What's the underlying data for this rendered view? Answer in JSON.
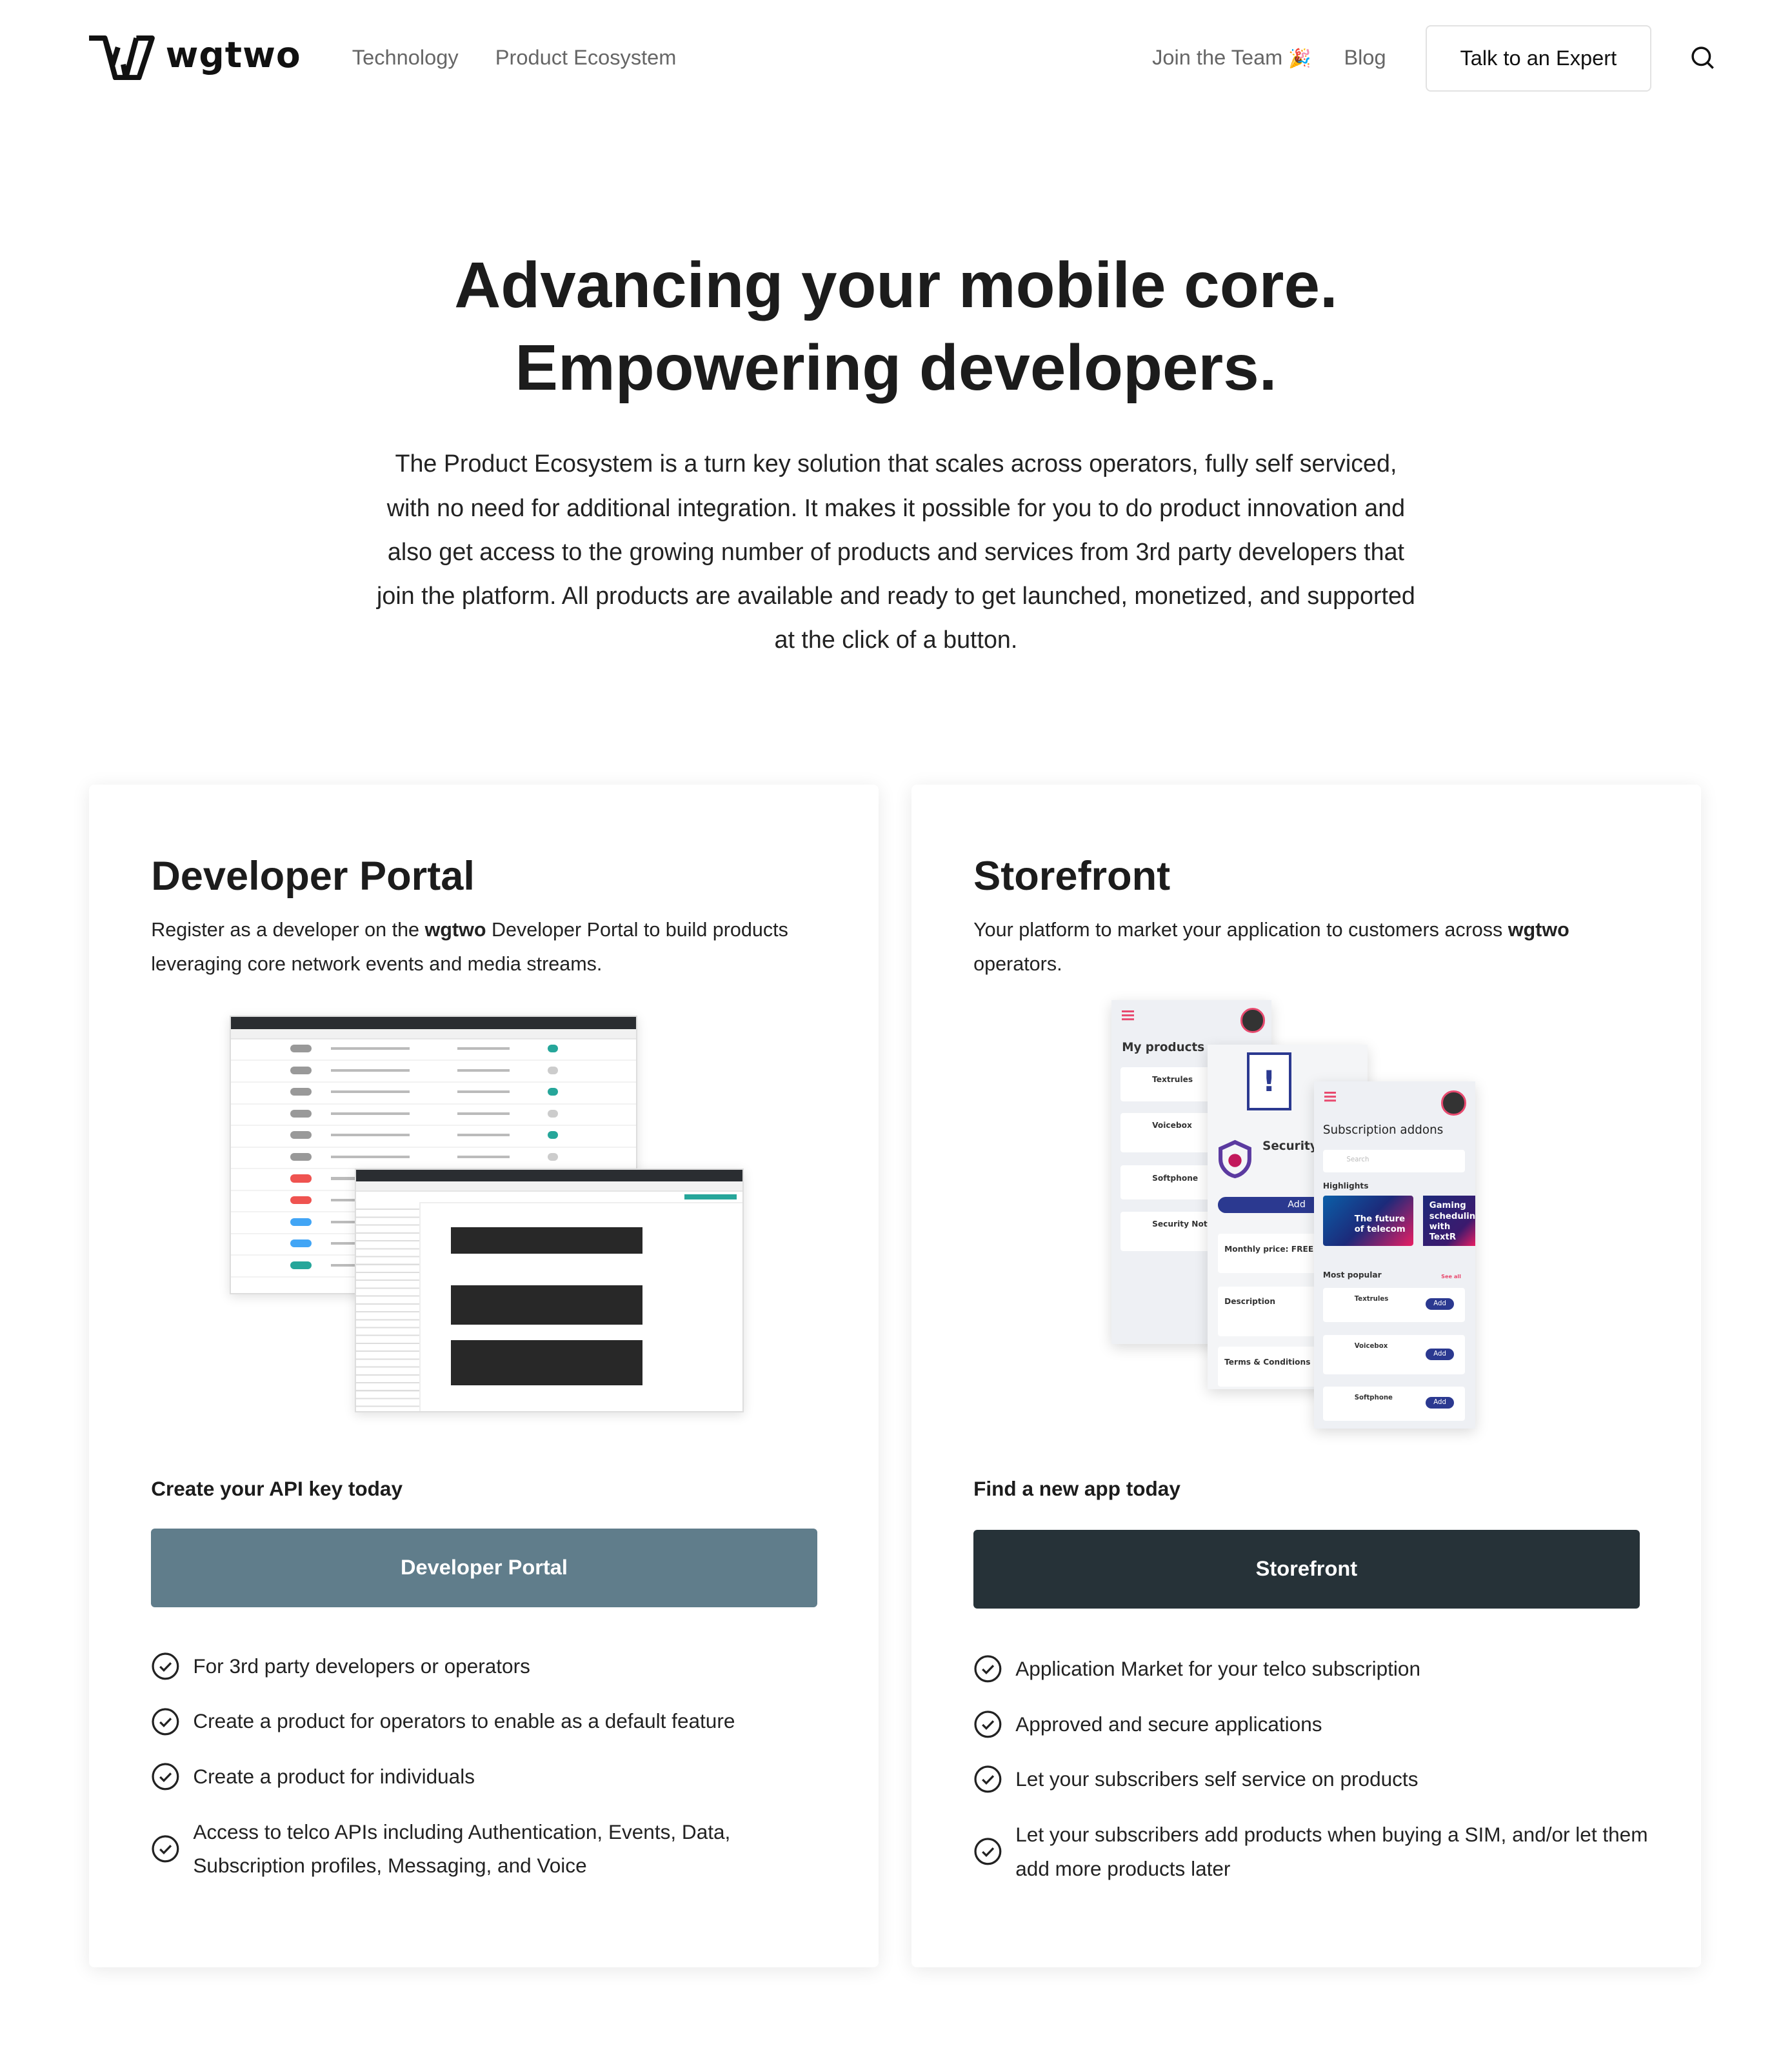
{
  "nav": {
    "logo_text": "wgtwo",
    "links": [
      "Technology",
      "Product Ecosystem"
    ],
    "right_links": [
      "Join the Team",
      "Blog"
    ],
    "join_emoji": "🎉",
    "cta": "Talk to an Expert",
    "search_icon": "search-icon"
  },
  "hero": {
    "title_line1": "Advancing your mobile core.",
    "title_line2": "Empowering developers.",
    "paragraph": "The Product Ecosystem is a turn key solution that scales across operators, fully self serviced, with no need for additional integration. It makes it possible for you to do product innovation and also get access to the growing number of products and services from 3rd party developers that join the platform. All products are available and ready to get launched, monetized, and supported at the click of a button."
  },
  "cards": [
    {
      "title": "Developer Portal",
      "desc_pre": "Register as a developer on the ",
      "desc_bold": "wgtwo",
      "desc_post": " Developer Portal to build products leveraging core network events and media streams.",
      "cta_label": "Create your API key today",
      "button": "Developer Portal",
      "button_color": "#607d8b",
      "features": [
        "For 3rd party developers or operators",
        "Create a product for operators to enable as a default feature",
        "Create a product for individuals",
        "Access to telco APIs including Authentication, Events, Data, Subscription profiles, Messaging, and Voice"
      ]
    },
    {
      "title": "Storefront",
      "desc_pre": "Your platform to market your application to customers across ",
      "desc_bold": "wgtwo",
      "desc_post": " operators.",
      "cta_label": "Find a new app today",
      "button": "Storefront",
      "button_color": "#263238",
      "features": [
        "Application Market for your telco subscription",
        "Approved and secure applications",
        "Let your subscribers self service on products",
        "Let your subscribers add products when buying a SIM, and/or let them add more products later"
      ]
    }
  ],
  "storefront_mock": {
    "my_products": "My products",
    "products": [
      "Textrules",
      "Voicebox",
      "Softphone",
      "Security Notifications"
    ],
    "security_title": "Security Notifications",
    "add": "Add",
    "monthly_price": "Monthly price: FREE",
    "description": "Description",
    "terms": "Terms & Conditions",
    "addons_title": "Subscription addons",
    "search": "Search",
    "highlights": "Highlights",
    "highlight_1": "The future of telecom",
    "highlight_2": "Gaming scheduling with TextR",
    "most_popular": "Most popular",
    "see_all": "See all"
  }
}
